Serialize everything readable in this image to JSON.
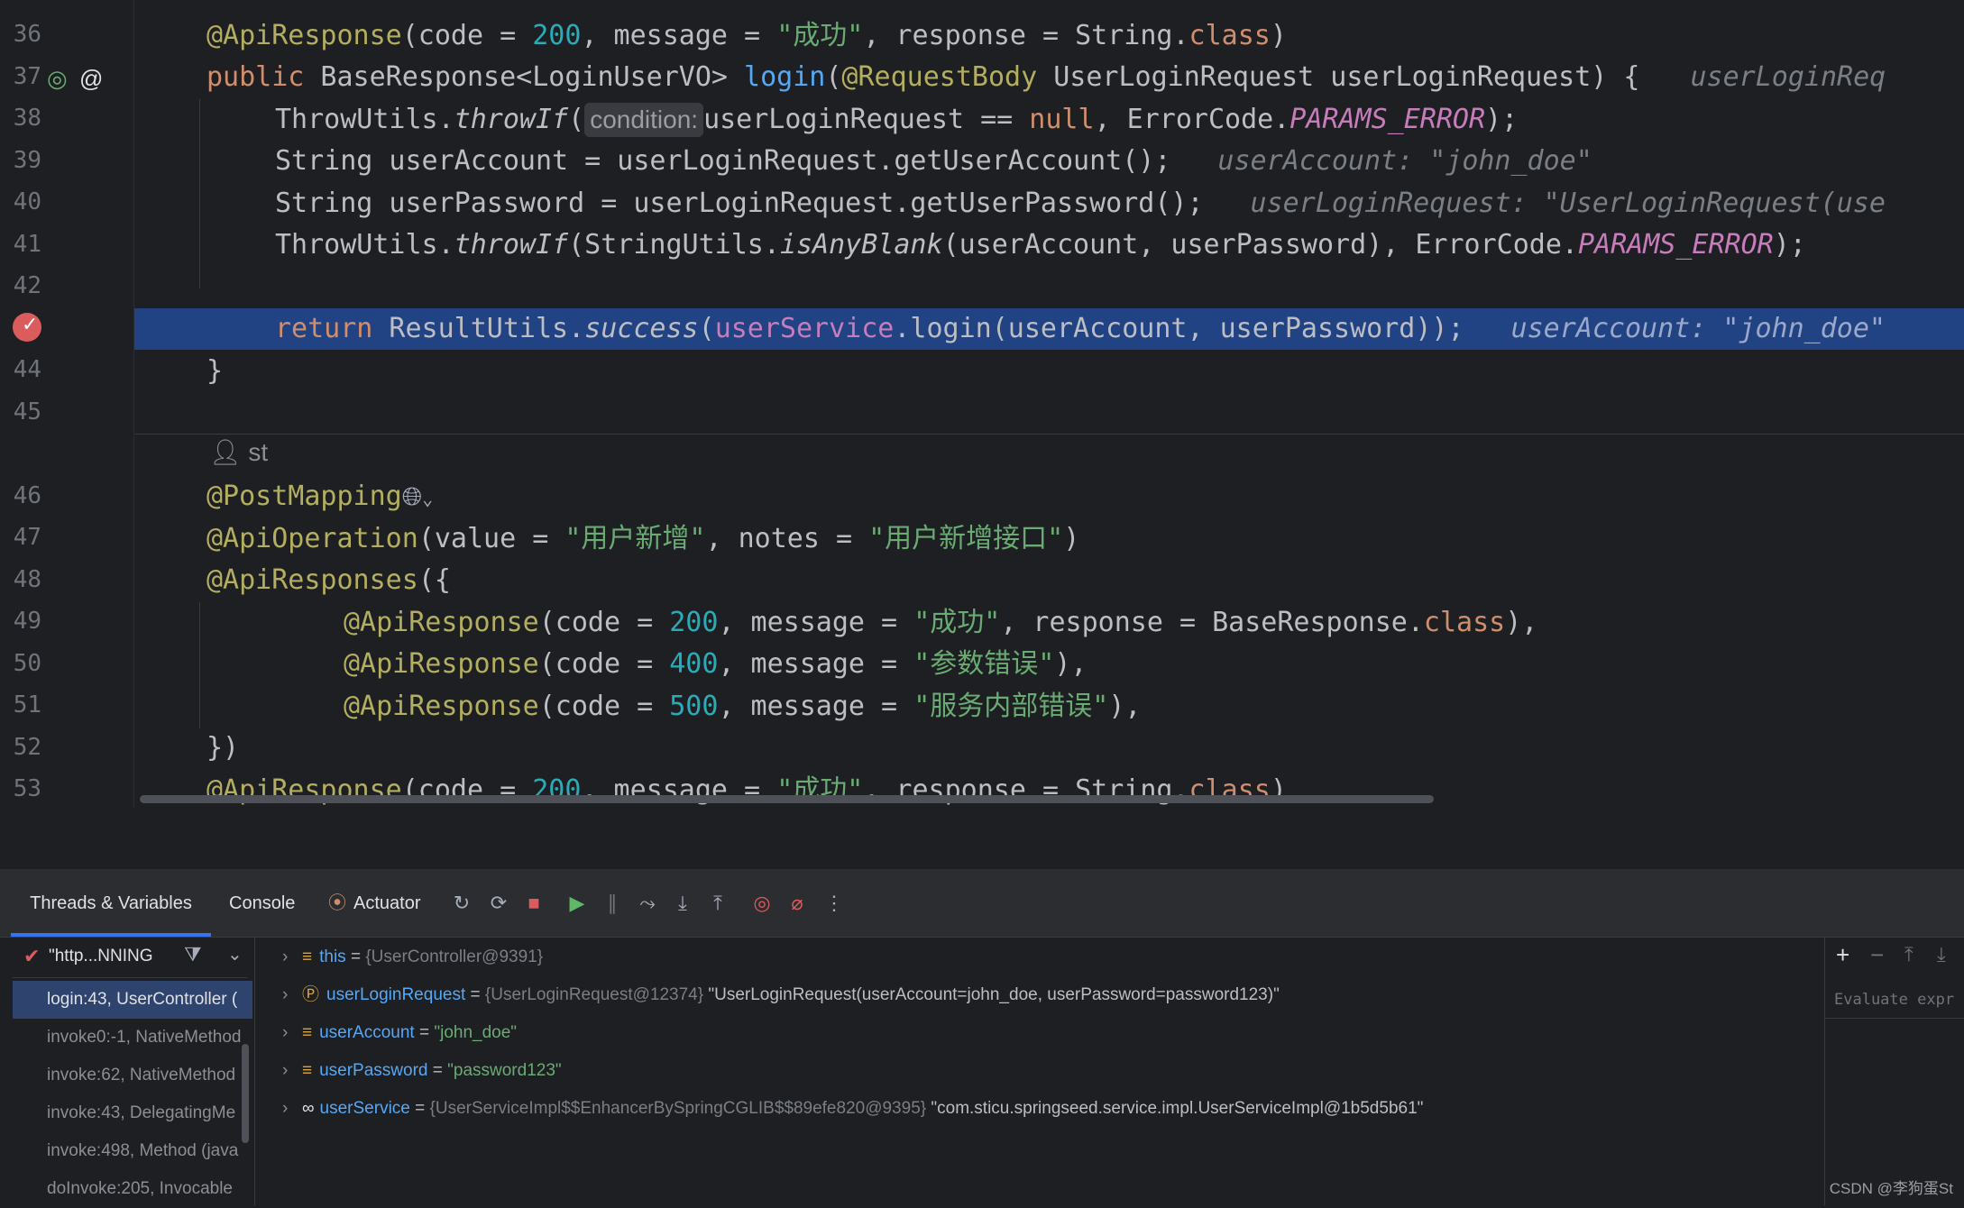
{
  "editor": {
    "line_numbers": [
      "36",
      "37",
      "38",
      "39",
      "40",
      "41",
      "42",
      "43",
      "44",
      "45",
      "46",
      "47",
      "48",
      "49",
      "50",
      "51",
      "52",
      "53"
    ],
    "author_hint": "st",
    "inlay_condition": "condition:",
    "lines": {
      "l36": {
        "ann": "@ApiResponse",
        "p1": "(code = ",
        "num": "200",
        "p2": ", message = ",
        "str": "\"成功\"",
        "p3": ", response = String.",
        "kw": "class",
        "p4": ")"
      },
      "l37": {
        "kw": "public",
        "p1": " BaseResponse<LoginUserVO> ",
        "fn": "login",
        "p2": "(",
        "ann": "@RequestBody",
        "p3": " UserLoginRequest userLoginRequest) {",
        "hint": "userLoginReq"
      },
      "l38": {
        "p1": "ThrowUtils.",
        "it": "throwIf",
        "p2": "(",
        "p3": "userLoginRequest == ",
        "kw": "null",
        "p4": ", ErrorCode.",
        "fld": "PARAMS_ERROR",
        "p5": ");"
      },
      "l39": {
        "p1": "String userAccount = userLoginRequest.getUserAccount();",
        "hint": "userAccount: \"john_doe\""
      },
      "l40": {
        "p1": "String userPassword = userLoginRequest.getUserPassword();",
        "hint": "userLoginRequest: \"UserLoginRequest(use"
      },
      "l41": {
        "p1": "ThrowUtils.",
        "it1": "throwIf",
        "p2": "(StringUtils.",
        "it2": "isAnyBlank",
        "p3": "(userAccount, userPassword), ErrorCode.",
        "fld": "PARAMS_ERROR",
        "p4": ");"
      },
      "l43": {
        "kw": "return",
        "p1": " ResultUtils.",
        "it": "success",
        "p2": "(",
        "fld": "userService",
        "p3": ".login(userAccount, userPassword));",
        "hint": "userAccount: \"john_doe\""
      },
      "l44": {
        "p1": "}"
      },
      "l46": {
        "ann": "@PostMapping"
      },
      "l47": {
        "ann": "@ApiOperation",
        "p1": "(value = ",
        "str1": "\"用户新增\"",
        "p2": ", notes = ",
        "str2": "\"用户新增接口\"",
        "p3": ")"
      },
      "l48": {
        "ann": "@ApiResponses",
        "p1": "({"
      },
      "l49": {
        "ann": "@ApiResponse",
        "p1": "(code = ",
        "num": "200",
        "p2": ", message = ",
        "str": "\"成功\"",
        "p3": ", response = BaseResponse.",
        "kw": "class",
        "p4": "),"
      },
      "l50": {
        "ann": "@ApiResponse",
        "p1": "(code = ",
        "num": "400",
        "p2": ", message = ",
        "str": "\"参数错误\"",
        "p3": "),"
      },
      "l51": {
        "ann": "@ApiResponse",
        "p1": "(code = ",
        "num": "500",
        "p2": ", message = ",
        "str": "\"服务内部错误\"",
        "p3": "),"
      },
      "l52": {
        "p1": "})"
      },
      "l53": {
        "ann": "@ApiResponse",
        "p1": "(code = ",
        "num": "200",
        "p2": ", message = ",
        "str": "\"成功\"",
        "p3": ", response = String.",
        "kw": "class",
        "p4": ")"
      }
    }
  },
  "debug": {
    "tabs": [
      "Threads & Variables",
      "Console",
      "Actuator"
    ],
    "thread_selector": "\"http...NNING",
    "frames": [
      "login:43, UserController (",
      "invoke0:-1, NativeMethod",
      "invoke:62, NativeMethod",
      "invoke:43, DelegatingMe",
      "invoke:498, Method (java",
      "doInvoke:205, Invocable"
    ],
    "variables": [
      {
        "name": "this",
        "eq": " = ",
        "type": "{UserController@9391}",
        "value": ""
      },
      {
        "name": "userLoginRequest",
        "eq": " = ",
        "type": "{UserLoginRequest@12374}",
        "value": " \"UserLoginRequest(userAccount=john_doe, userPassword=password123)\""
      },
      {
        "name": "userAccount",
        "eq": " = ",
        "type": "",
        "value": "\"john_doe\""
      },
      {
        "name": "userPassword",
        "eq": " = ",
        "type": "",
        "value": "\"password123\""
      },
      {
        "name": "userService",
        "eq": " = ",
        "type": "{UserServiceImpl$$EnhancerBySpringCGLIB$$89efe820@9395}",
        "value": " \"com.sticu.springseed.service.impl.UserServiceImpl@1b5d5b61\""
      }
    ],
    "evaluate_placeholder": "Evaluate expr",
    "watermark": "CSDN @李狗蛋St"
  },
  "colors": {
    "accent": "#3574f0",
    "highlight": "#214283",
    "breakpoint": "#db5c5c"
  },
  "icons": [
    "rerun-icon",
    "restart-icon",
    "stop-icon",
    "resume-icon",
    "pause-icon",
    "step-over-icon",
    "step-into-icon",
    "step-out-icon",
    "view-breakpoints-icon",
    "mute-breakpoints-icon",
    "more-icon",
    "filter-icon",
    "plus-icon",
    "minus-icon",
    "move-up-icon",
    "move-down-icon"
  ]
}
